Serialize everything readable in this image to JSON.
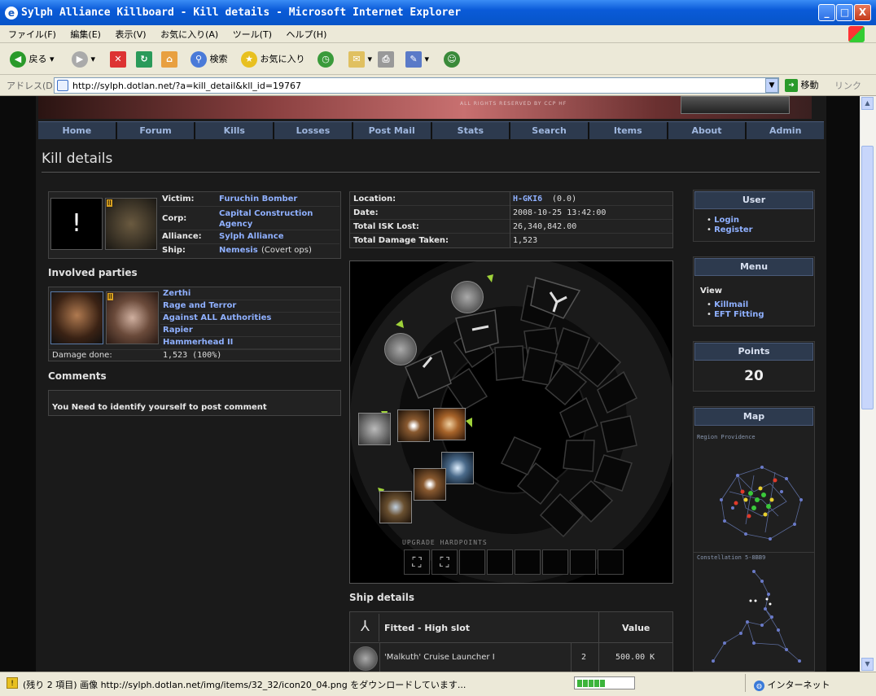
{
  "window": {
    "title": "Sylph Alliance Killboard - Kill details - Microsoft Internet Explorer",
    "min_label": "_",
    "max_label": "□",
    "close_label": "X"
  },
  "menubar": [
    "ファイル(F)",
    "編集(E)",
    "表示(V)",
    "お気に入り(A)",
    "ツール(T)",
    "ヘルプ(H)"
  ],
  "toolbar": {
    "back": "戻る",
    "search": "検索",
    "favorites": "お気に入り"
  },
  "address": {
    "label": "アドレス(D)",
    "url": "http://sylph.dotlan.net/?a=kill_detail&kll_id=19767",
    "go": "移動",
    "links": "リンク"
  },
  "banner_text": "ALL RIGHTS RESERVED BY CCP HF",
  "nav": [
    "Home",
    "Forum",
    "Kills",
    "Losses",
    "Post Mail",
    "Stats",
    "Search",
    "Items",
    "About",
    "Admin"
  ],
  "page_title": "Kill details",
  "victim": {
    "portrait_symbol": "!",
    "ship_badge": "II",
    "rows": [
      {
        "label": "Victim:",
        "value": "Furuchin Bomber",
        "extra": ""
      },
      {
        "label": "Corp:",
        "value": "Capital Construction Agency",
        "extra": ""
      },
      {
        "label": "Alliance:",
        "value": "Sylph Alliance",
        "extra": ""
      },
      {
        "label": "Ship:",
        "value": "Nemesis",
        "extra": "(Covert ops)"
      }
    ]
  },
  "location": {
    "rows": [
      {
        "label": "Location:",
        "value": "H-GKI6",
        "extra": "(0.0)"
      },
      {
        "label": "Date:",
        "value": "2008-10-25 13:42:00"
      },
      {
        "label": "Total ISK Lost:",
        "value": "26,340,842.00"
      },
      {
        "label": "Total Damage Taken:",
        "value": "1,523"
      }
    ]
  },
  "involved": {
    "heading": "Involved parties",
    "ship_badge": "II",
    "rows": [
      "Zerthi",
      "Rage and Terror",
      "Against ALL Authorities",
      "Rapier",
      "Hammerhead II"
    ],
    "damage_label": "Damage done:",
    "damage_value": "1,523 (100%)"
  },
  "comments": {
    "heading": "Comments",
    "message": "You Need to identify yourself to post comment"
  },
  "fitting": {
    "upgrade_label": "UPGRADE HARDPOINTS"
  },
  "ship_details": {
    "heading": "Ship details",
    "col_fitted": "Fitted - High slot",
    "col_value": "Value",
    "rows": [
      {
        "name": "'Malkuth' Cruise Launcher I",
        "qty": "2",
        "value": "500.00 K"
      }
    ]
  },
  "sidebar": {
    "user": {
      "title": "User",
      "links": [
        "Login",
        "Register"
      ]
    },
    "menu": {
      "title": "Menu",
      "view_label": "View",
      "links": [
        "Killmail",
        "EFT Fitting"
      ]
    },
    "points": {
      "title": "Points",
      "value": "20"
    },
    "map": {
      "title": "Map",
      "region": "Region Providence",
      "constellation": "Constellation 5-8BB9"
    }
  },
  "status": {
    "text": "(残り 2 項目) 画像 http://sylph.dotlan.net/img/items/32_32/icon20_04.png をダウンロードしています...",
    "zone": "インターネット",
    "progress": 0.45
  },
  "colors": {
    "nav_bg": "#2d3a4e",
    "link": "#8fb0ff",
    "page_bg": "#1a1a1a"
  }
}
